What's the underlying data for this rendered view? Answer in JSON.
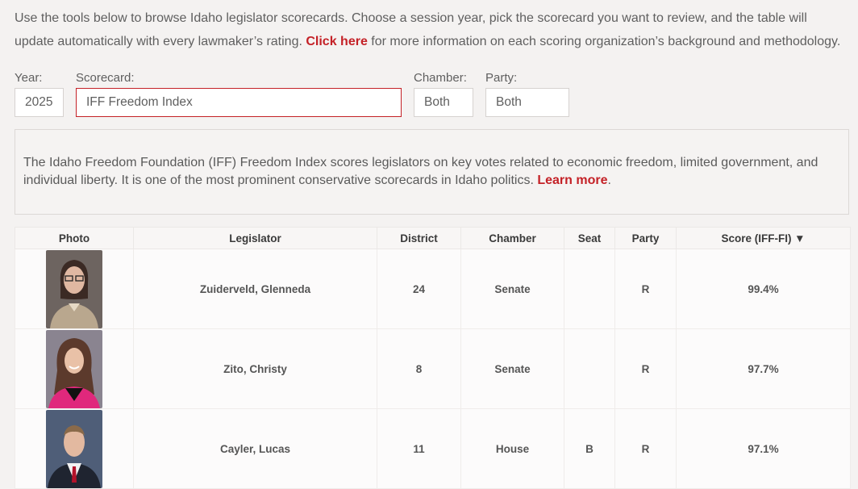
{
  "intro": {
    "text_before": "Use the tools below to browse Idaho legislator scorecards. Choose a session year, pick the scorecard you want to review, and the table will update automatically with every lawmaker’s rating.",
    "link": "Click here",
    "text_after": "for more information on each scoring organization’s background and methodology."
  },
  "filters": {
    "year": {
      "label": "Year:",
      "value": "2025"
    },
    "scorecard": {
      "label": "Scorecard:",
      "value": "IFF Freedom Index"
    },
    "chamber": {
      "label": "Chamber:",
      "value": "Both"
    },
    "party": {
      "label": "Party:",
      "value": "Both"
    }
  },
  "description": {
    "text": "The Idaho Freedom Foundation (IFF) Freedom Index scores legislators on key votes related to economic freedom, limited government, and individual liberty. It is one of the most prominent conservative scorecards in Idaho politics.",
    "link": "Learn more",
    "trail": "."
  },
  "table": {
    "headers": [
      "Photo",
      "Legislator",
      "District",
      "Chamber",
      "Seat",
      "Party",
      "Score (IFF-FI) ▼"
    ],
    "rows": [
      {
        "name": "Zuiderveld, Glenneda",
        "district": "24",
        "chamber": "Senate",
        "seat": "",
        "party": "R",
        "score": "99.4%"
      },
      {
        "name": "Zito, Christy",
        "district": "8",
        "chamber": "Senate",
        "seat": "",
        "party": "R",
        "score": "97.7%"
      },
      {
        "name": "Cayler, Lucas",
        "district": "11",
        "chamber": "House",
        "seat": "B",
        "party": "R",
        "score": "97.1%"
      }
    ]
  }
}
